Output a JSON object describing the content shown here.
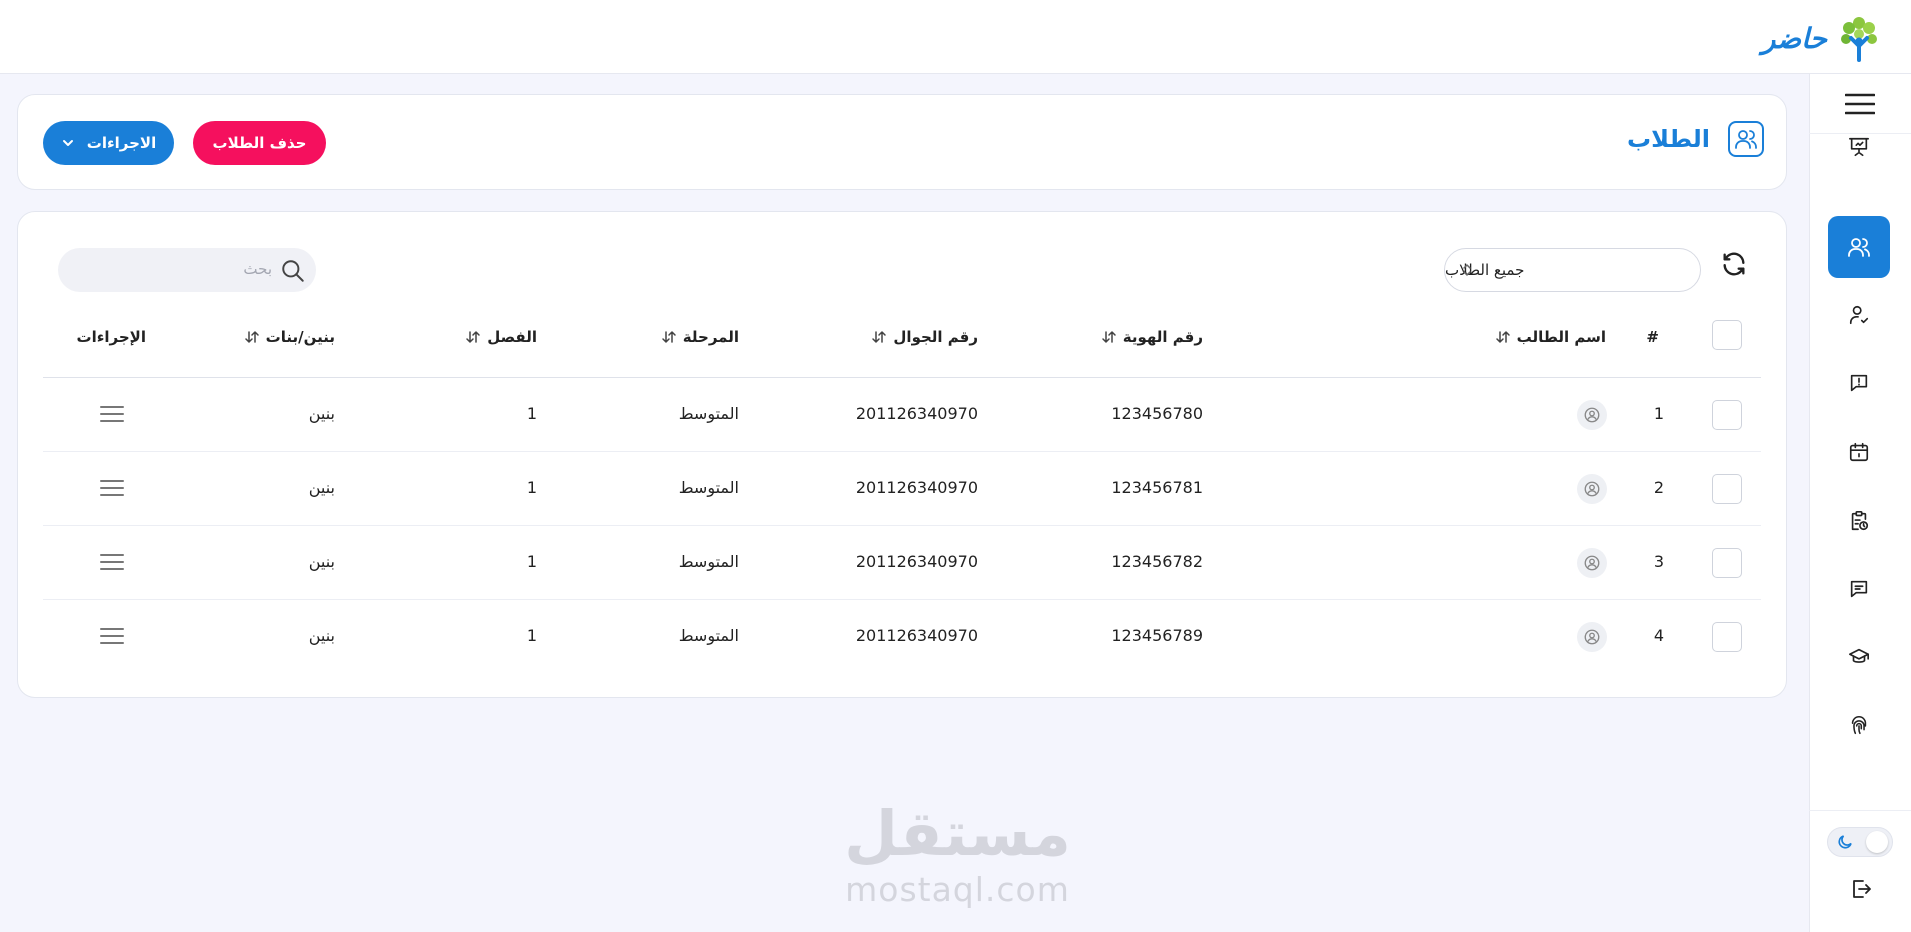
{
  "brand": {
    "name": "حاضر"
  },
  "header": {
    "title": "الطلاب",
    "delete_button": "حذف الطلاب",
    "actions_button": "الاجراءات"
  },
  "sidebar": {
    "items": [
      {
        "icon": "presentation-board-icon",
        "active": false
      },
      {
        "icon": "users-icon",
        "active": true
      },
      {
        "icon": "user-check-icon",
        "active": false
      },
      {
        "icon": "message-alert-icon",
        "active": false
      },
      {
        "icon": "calendar-icon",
        "active": false
      },
      {
        "icon": "clipboard-clock-icon",
        "active": false
      },
      {
        "icon": "chat-icon",
        "active": false
      },
      {
        "icon": "graduation-cap-icon",
        "active": false
      },
      {
        "icon": "fingerprint-icon",
        "active": false
      }
    ]
  },
  "filters": {
    "selected": "جميع الطلاب",
    "search_placeholder": "بحث"
  },
  "table": {
    "columns": [
      "#",
      "اسم الطالب",
      "رقم الهوية",
      "رقم الجوال",
      "المرحلة",
      "الفصل",
      "بنين/بنات",
      "الإجراءات"
    ],
    "rows": [
      {
        "num": "1",
        "id": "123456780",
        "phone": "201126340970",
        "stage": "المتوسط",
        "class": "1",
        "gender": "بنين"
      },
      {
        "num": "2",
        "id": "123456781",
        "phone": "201126340970",
        "stage": "المتوسط",
        "class": "1",
        "gender": "بنين"
      },
      {
        "num": "3",
        "id": "123456782",
        "phone": "201126340970",
        "stage": "المتوسط",
        "class": "1",
        "gender": "بنين"
      },
      {
        "num": "4",
        "id": "123456789",
        "phone": "201126340970",
        "stage": "المتوسط",
        "class": "1",
        "gender": "بنين"
      }
    ]
  },
  "watermark": {
    "arabic": "مستقل",
    "latin": "mostaql.com"
  },
  "colors": {
    "primary": "#1a7fd8",
    "danger": "#f5105e",
    "background": "#f4f5fd"
  }
}
